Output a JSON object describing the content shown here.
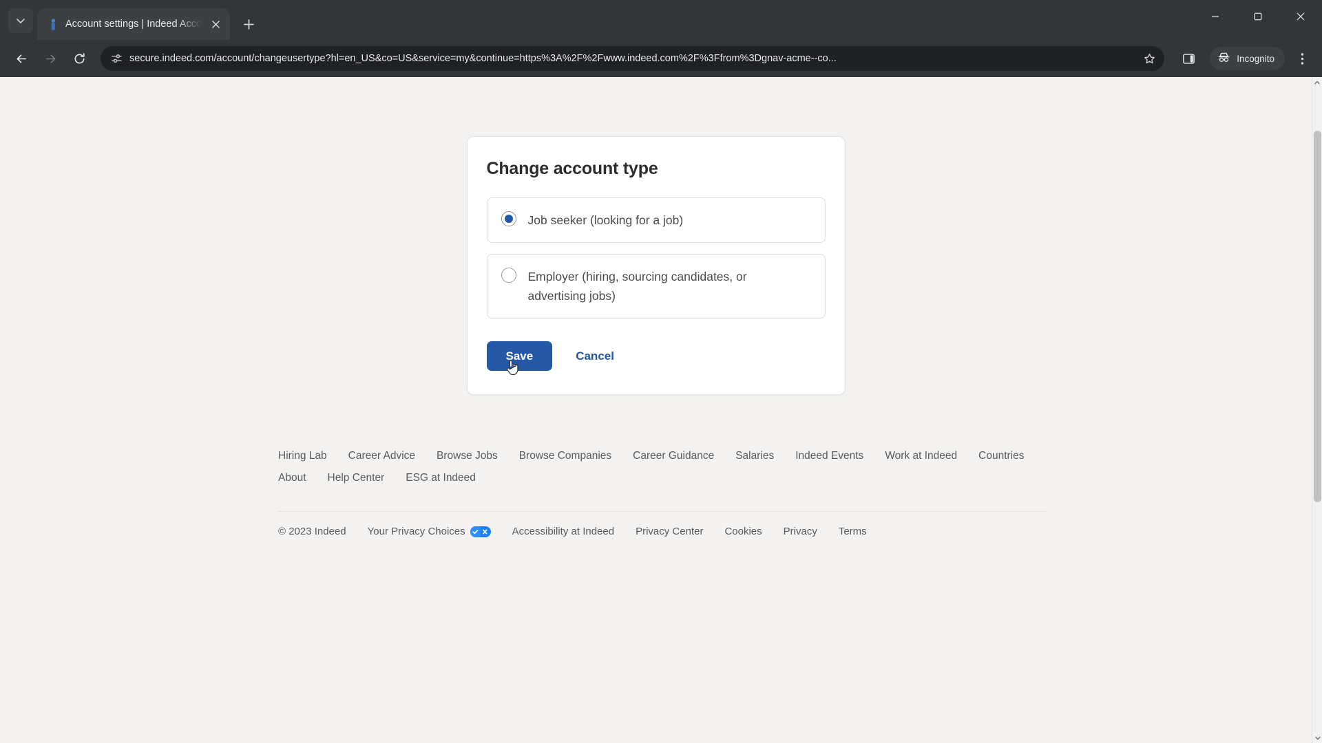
{
  "browser": {
    "tab": {
      "title": "Account settings | Indeed Acco",
      "favicon_name": "indeed-favicon"
    },
    "new_tab_label": "+",
    "url": "secure.indeed.com/account/changeusertype?hl=en_US&co=US&service=my&continue=https%3A%2F%2Fwww.indeed.com%2F%3Ffrom%3Dgnav-acme--co...",
    "incognito_label": "Incognito",
    "accent": "#2557a7"
  },
  "card": {
    "title": "Change account type",
    "options": [
      {
        "label": "Job seeker (looking for a job)",
        "selected": true
      },
      {
        "label": "Employer (hiring, sourcing candidates, or advertising jobs)",
        "selected": false
      }
    ],
    "save_label": "Save",
    "cancel_label": "Cancel"
  },
  "footer": {
    "links_row1": [
      "Hiring Lab",
      "Career Advice",
      "Browse Jobs",
      "Browse Companies",
      "Career Guidance",
      "Salaries",
      "Indeed Events",
      "Work at Indeed",
      "Countries"
    ],
    "links_row2": [
      "About",
      "Help Center",
      "ESG at Indeed"
    ],
    "copyright": "© 2023 Indeed",
    "privacy_choices_label": "Your Privacy Choices",
    "legal_links": [
      "Accessibility at Indeed",
      "Privacy Center",
      "Cookies",
      "Privacy",
      "Terms"
    ]
  }
}
